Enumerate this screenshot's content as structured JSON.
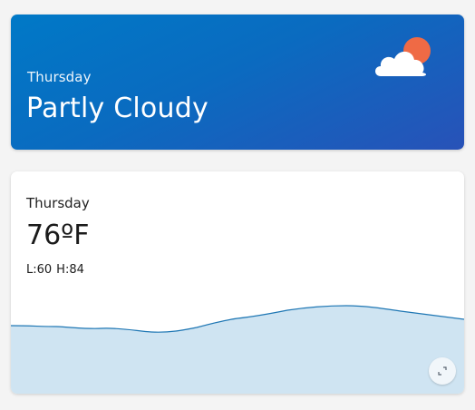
{
  "hero": {
    "day": "Thursday",
    "condition": "Partly Cloudy",
    "icon": "partly-cloudy-icon",
    "gradient_start": "#0079c7",
    "gradient_end": "#2852b8"
  },
  "detail": {
    "day": "Thursday",
    "temperature": "76ºF",
    "low": "L:60",
    "high": "H:84",
    "expand_icon": "expand-icon"
  },
  "colors": {
    "sun": "#ef6a45",
    "cloud": "#ffffff",
    "line": "#1f77b4",
    "area": "#cfe4f2",
    "page_bg": "#f4f4f4"
  }
}
